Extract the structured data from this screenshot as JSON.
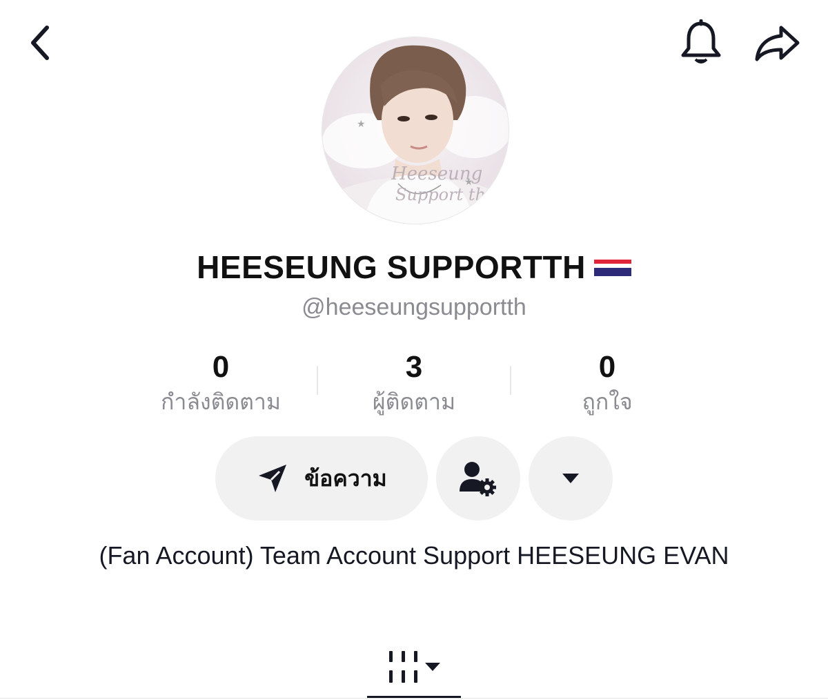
{
  "header": {
    "back_icon": "chevron-left-icon",
    "bell_icon": "bell-icon",
    "share_icon": "share-arrow-icon"
  },
  "profile": {
    "display_name": "HEESEUNG SUPPORTTH",
    "flag": "Thailand flag",
    "handle": "@heeseungsupportth",
    "avatar_caption_line1": "Heeseung",
    "avatar_caption_line2": "Support th"
  },
  "stats": [
    {
      "value": "0",
      "label": "กำลังติดตาม"
    },
    {
      "value": "3",
      "label": "ผู้ติดตาม"
    },
    {
      "value": "0",
      "label": "ถูกใจ"
    }
  ],
  "actions": {
    "message_label": "ข้อความ",
    "message_icon": "send-icon",
    "manage_icon": "user-settings-icon",
    "more_icon": "caret-down-icon"
  },
  "bio": "(Fan Account) Team Account Support HEESEUNG EVAN",
  "tabs": {
    "grid_icon": "grid-icon",
    "dropdown_icon": "caret-down-icon"
  },
  "colors": {
    "text_primary": "#161823",
    "text_secondary": "#8a8b91",
    "button_bg": "#f1f1f2",
    "divider": "#e7e7e9"
  }
}
